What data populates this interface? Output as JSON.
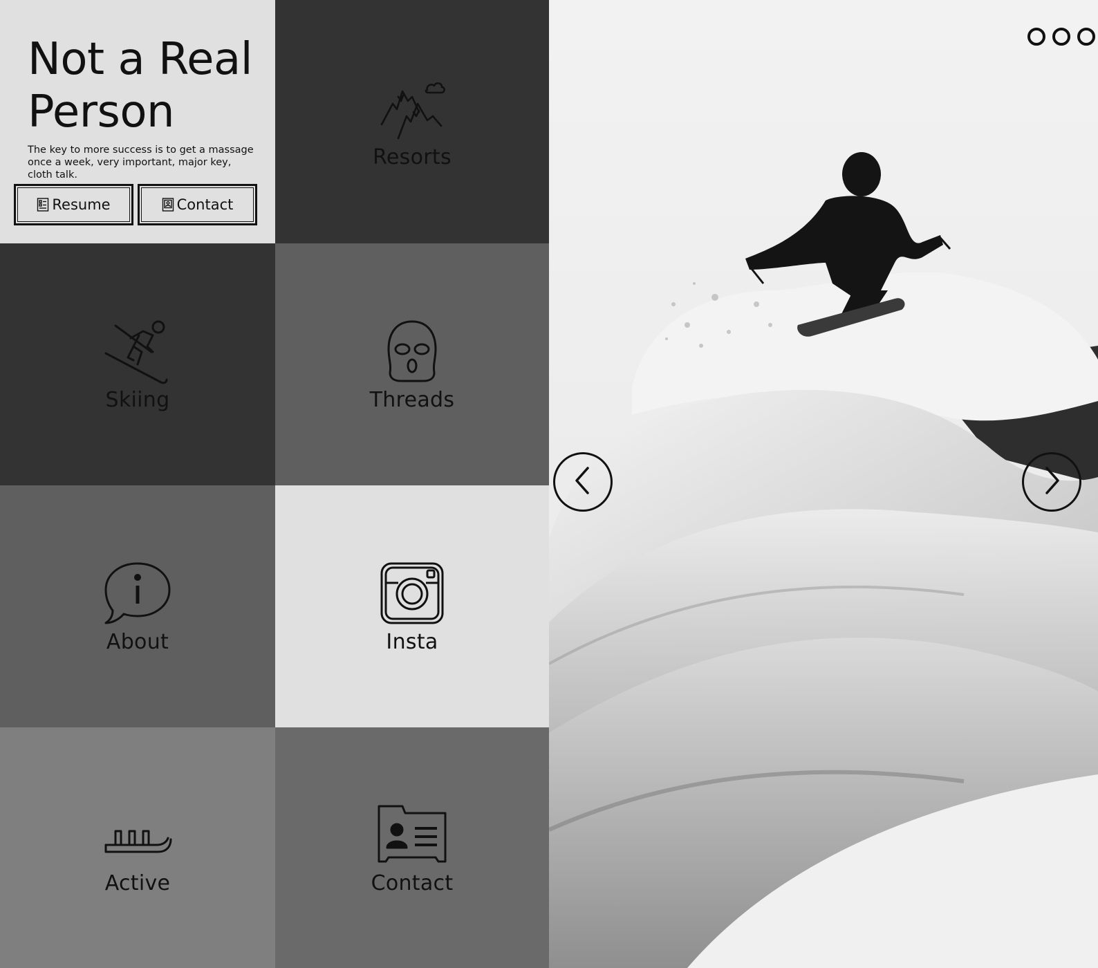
{
  "intro": {
    "title": "Not a Real Person",
    "tagline": "The key to more success is to get a massage once a week, very important, major key, cloth talk.",
    "buttons": [
      {
        "label": "Resume",
        "icon": "resume-icon"
      },
      {
        "label": "Contact",
        "icon": "contact-card-icon"
      }
    ]
  },
  "tiles": [
    {
      "label": "Resorts",
      "icon": "mountains-icon",
      "color": "#333333"
    },
    {
      "label": "Skiing",
      "icon": "skier-icon",
      "color": "#333333"
    },
    {
      "label": "Threads",
      "icon": "ski-mask-icon",
      "color": "#5f5f5f"
    },
    {
      "label": "About",
      "icon": "info-bubble-icon",
      "color": "#5f5f5f"
    },
    {
      "label": "Insta",
      "icon": "camera-icon",
      "color": "#e0e0e0"
    },
    {
      "label": "Active",
      "icon": "sled-icon",
      "color": "#7f7f7f"
    },
    {
      "label": "Contact",
      "icon": "contact-card-icon",
      "color": "#6a6a6a"
    }
  ],
  "carousel": {
    "slide_count": 3,
    "image": "black-and-white photo of a skier jumping off a snow pillow",
    "prev_icon": "chevron-left-icon",
    "next_icon": "chevron-right-icon"
  },
  "colors": {
    "light": "#e0e0e0",
    "dark": "#333333",
    "ink": "#111111"
  }
}
